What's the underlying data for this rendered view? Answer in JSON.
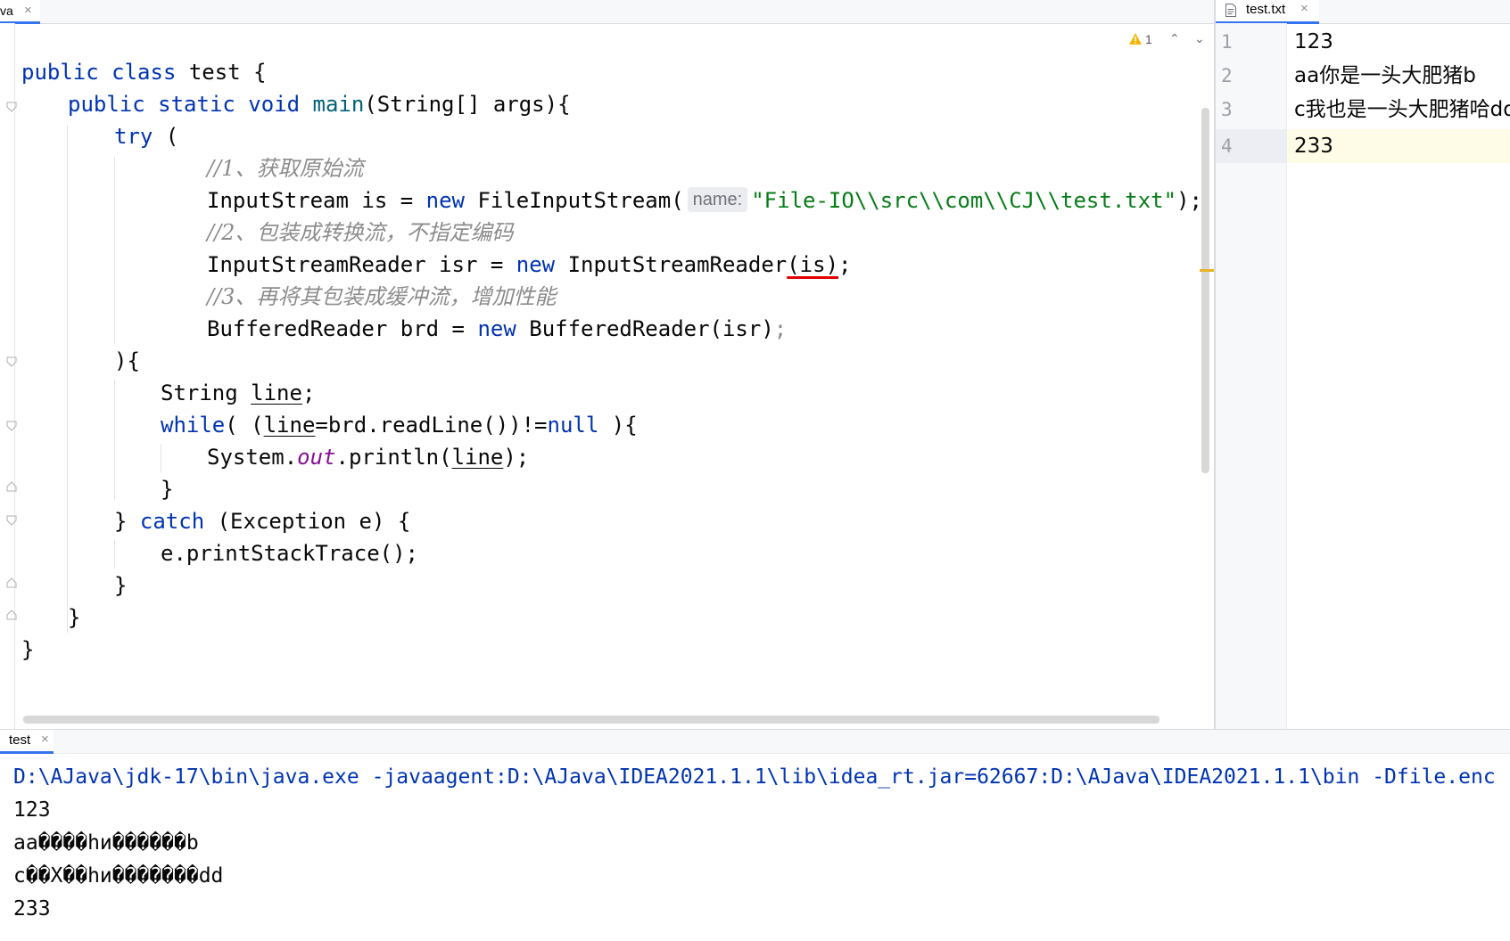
{
  "editor": {
    "tab_label": "va",
    "tab_close": "×",
    "inspection": {
      "warning_count": "1",
      "up_icon": "⌃",
      "down_icon": "⌄"
    },
    "code": {
      "l1": {
        "kw": "public class",
        "rest": " test {"
      },
      "l2": {
        "kw": "public static void",
        "fn": "main",
        "rest": "(String[] args){"
      },
      "l3": {
        "kw": "try",
        "rest": " ("
      },
      "l4": {
        "comment": "//1、获取原始流"
      },
      "l5": {
        "a": "InputStream is = ",
        "kw": "new",
        "b": " FileInputStream(",
        "hint": "name:",
        "str": "\"File-IO\\\\src\\\\com\\\\CJ\\\\test.txt\"",
        "c": ");"
      },
      "l6": {
        "comment": "//2、包装成转换流，不指定编码"
      },
      "l7": {
        "a": "InputStreamReader isr = ",
        "kw": "new",
        "b": " InputStreamReader",
        "err": "(is)",
        "c": ";"
      },
      "l8": {
        "comment": "//3、再将其包装成缓冲流，增加性能"
      },
      "l9": {
        "a": "BufferedReader brd = ",
        "kw": "new",
        "b": " BufferedReader(isr)",
        "c": ";"
      },
      "l10": {
        "text": "){"
      },
      "l11": {
        "a": "String ",
        "var": "line",
        "b": ";"
      },
      "l12": {
        "kw": "while",
        "a": "( (",
        "var": "line",
        "b": "=brd.readLine())!=",
        "kw2": "null",
        "c": " ){"
      },
      "l13": {
        "a": "System.",
        "field": "out",
        "b": ".println(",
        "var": "line",
        "c": ");"
      },
      "l14": {
        "text": "}"
      },
      "l15": {
        "a": "} ",
        "kw": "catch",
        "b": " (Exception e) {"
      },
      "l16": {
        "text": "e.printStackTrace();"
      },
      "l17": {
        "text": "}"
      },
      "l18": {
        "text": "}"
      },
      "l19": {
        "text": "}"
      }
    }
  },
  "right_pane": {
    "tab_label": "test.txt",
    "tab_close": "×",
    "line_numbers": [
      "1",
      "2",
      "3",
      "4"
    ],
    "lines": [
      "123",
      "aa你是一头大肥猪b",
      "c我也是一头大肥猪哈dd",
      "233"
    ]
  },
  "console": {
    "tab_label": "test",
    "tab_close": "×",
    "command": "D:\\AJava\\jdk-17\\bin\\java.exe -javaagent:D:\\AJava\\IDEA2021.1.1\\lib\\idea_rt.jar=62667:D:\\AJava\\IDEA2021.1.1\\bin -Dfile.enc",
    "output": [
      "123",
      "aa����hи������b",
      "c��Χ��hи�������dd",
      "233"
    ]
  },
  "colors": {
    "keyword": "#0033b3",
    "string": "#067d17",
    "comment": "#8c8c8c",
    "method": "#00627a",
    "static_field": "#871094",
    "error_underline": "#e00000",
    "tab_accent": "#3574f0"
  }
}
